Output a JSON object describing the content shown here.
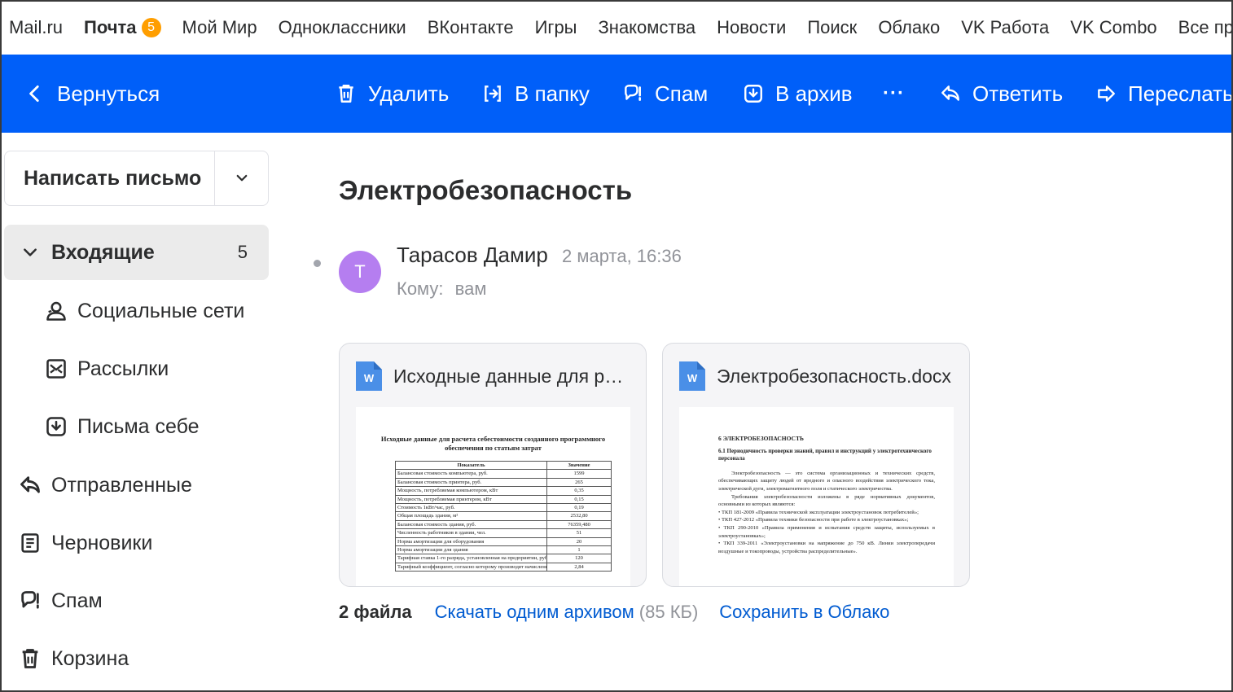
{
  "portal_nav": [
    {
      "label": "Mail.ru"
    },
    {
      "label": "Почта",
      "badge": "5"
    },
    {
      "label": "Мой Мир"
    },
    {
      "label": "Одноклассники"
    },
    {
      "label": "ВКонтакте"
    },
    {
      "label": "Игры"
    },
    {
      "label": "Знакомства"
    },
    {
      "label": "Новости"
    },
    {
      "label": "Поиск"
    },
    {
      "label": "Облако"
    },
    {
      "label": "VK Работа"
    },
    {
      "label": "VK Combo"
    },
    {
      "label": "Все проекты"
    }
  ],
  "toolbar": {
    "back": "Вернуться",
    "delete": "Удалить",
    "move": "В папку",
    "spam": "Спам",
    "archive": "В архив",
    "more": "···",
    "reply": "Ответить",
    "forward": "Переслать",
    "bg_color": "#005ff9"
  },
  "sidebar": {
    "compose": "Написать письмо",
    "inbox": {
      "label": "Входящие",
      "count": "5"
    },
    "subfolders": [
      {
        "label": "Социальные сети",
        "icon": "people-icon"
      },
      {
        "label": "Рассылки",
        "icon": "newsletter-icon"
      },
      {
        "label": "Письма себе",
        "icon": "self-mail-icon"
      }
    ],
    "folders": [
      {
        "label": "Отправленные",
        "icon": "sent-icon"
      },
      {
        "label": "Черновики",
        "icon": "drafts-icon"
      },
      {
        "label": "Спам",
        "icon": "spam-icon"
      },
      {
        "label": "Корзина",
        "icon": "trash-icon"
      }
    ]
  },
  "message": {
    "subject": "Электробезопасность",
    "avatar_letter": "Т",
    "avatar_color": "#b57ef0",
    "sender": "Тарасов Дамир",
    "date": "2 марта, 16:36",
    "to_label": "Кому:",
    "to_value": "вам"
  },
  "attachments": [
    {
      "name": "Исходные данные для расчета себестоимости.docx",
      "preview": {
        "title": "Исходные данные для расчета себестоимости созданного программного обеспечения по статьям затрат",
        "headers": [
          "Показатель",
          "Значение"
        ],
        "rows": [
          [
            "Балансовая стоимость компьютера, руб.",
            "1599"
          ],
          [
            "Балансовая стоимость принтера, руб.",
            "265"
          ],
          [
            "Мощность, потребляемая компьютером, кВт",
            "0,35"
          ],
          [
            "Мощность, потребляемая принтером, кВт",
            "0,15"
          ],
          [
            "Стоимость 1кВт/час, руб.",
            "0,19"
          ],
          [
            "Общая площадь здания, м²",
            "2532,80"
          ],
          [
            "Балансовая стоимость здания, руб.",
            "76359,480"
          ],
          [
            "Численность работников в здании, чел.",
            "51"
          ],
          [
            "Норма амортизации для оборудования",
            "20"
          ],
          [
            "Норма амортизации для здания",
            "1"
          ],
          [
            "Тарифная ставка 1-го разряда, установленная на предприятии, руб.",
            "120"
          ],
          [
            "Тарифный коэффициент, согласно которому производят начисление зарплаты",
            "2,84"
          ]
        ]
      }
    },
    {
      "name": "Электробезопасность.docx",
      "preview": {
        "heading": "6 ЭЛЕКТРОБЕЗОПАСНОСТЬ",
        "subheading": "6.1 Периодичность проверки знаний, правил и инструкций у электротехнического персонала",
        "paragraphs": [
          "Электробезопасность — это система организационных и технических средств, обеспечивающих защиту людей от вредного и опасного воздействия электрического тока, электрической дуги, электромагнитного поля и статического электричества.",
          "Требования электробезопасности изложены в ряде нормативных документов, основными из которых являются:",
          "• ТКП 181-2009 «Правила технической эксплуатации электроустановок потребителей»;",
          "• ТКП 427-2012 «Правила техники безопасности при работе в электроустановках»;",
          "• ТКП 290-2010 «Правила применения и испытания средств защиты, используемых в электроустановках»;",
          "• ТКП 339-2011 «Электроустановки на напряжение до 750 кВ. Линии электропередачи воздушные и токопроводы, устройства распределительные»."
        ]
      }
    }
  ],
  "files_bar": {
    "count": "2 файла",
    "download": "Скачать одним архивом",
    "size": "(85 КБ)",
    "save_cloud": "Сохранить в Облако"
  }
}
